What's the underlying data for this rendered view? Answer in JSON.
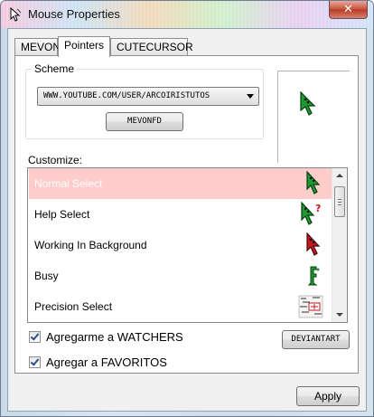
{
  "window": {
    "title": "Mouse Properties",
    "close_glyph": "✕"
  },
  "tabs": [
    {
      "label": "MEVON",
      "active": false
    },
    {
      "label": "Pointers",
      "active": true
    },
    {
      "label": "CUTECURSOR",
      "active": false
    }
  ],
  "scheme": {
    "group_label": "Scheme",
    "selected": "WWW.YOUTUBE.COM/USER/ARCOIRISTUTOS",
    "button_label": "MEVONFD"
  },
  "customize": {
    "label": "Customize:",
    "items": [
      {
        "label": "Normal Select",
        "icon": "green-arrow-cursor-icon",
        "selected": true
      },
      {
        "label": "Help Select",
        "icon": "green-help-cursor-icon",
        "selected": false
      },
      {
        "label": "Working In Background",
        "icon": "red-arrow-cursor-icon",
        "selected": false
      },
      {
        "label": "Busy",
        "icon": "green-busy-cursor-icon",
        "selected": false
      },
      {
        "label": "Precision Select",
        "icon": "precision-cursor-icon",
        "selected": false
      }
    ]
  },
  "checks": [
    {
      "label": "Agregarme a WATCHERS",
      "checked": true
    },
    {
      "label": "Agregar a FAVORITOS",
      "checked": true
    }
  ],
  "deviantart_label": "DEVIANTART",
  "apply_label": "Apply",
  "colors": {
    "selection": "#ffcccc",
    "cursor_green": "#1f9a2e",
    "cursor_red": "#c4161c"
  }
}
